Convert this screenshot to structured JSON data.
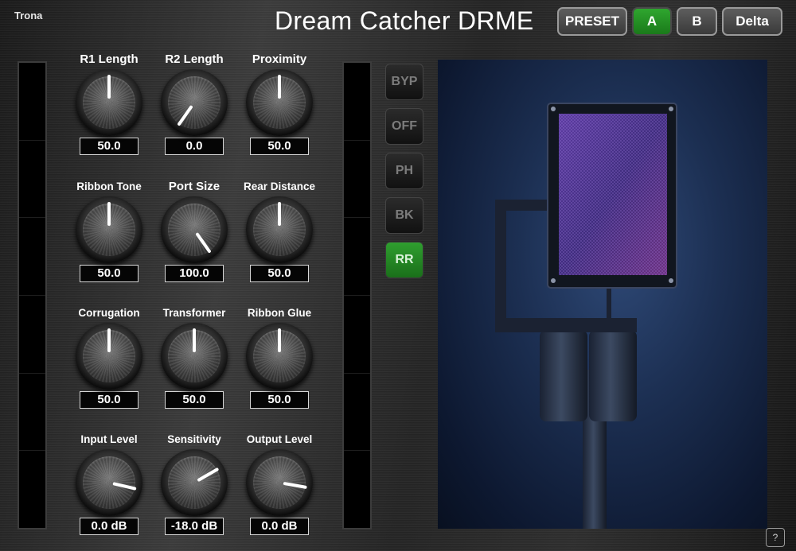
{
  "brand": "Trona",
  "title": "Dream Catcher DRME",
  "top_buttons": {
    "preset": "PRESET",
    "a": "A",
    "b": "B",
    "delta": "Delta",
    "active": "A"
  },
  "controls": [
    {
      "label": "R1 Length",
      "value": "50.0"
    },
    {
      "label": "R2 Length",
      "value": "0.0"
    },
    {
      "label": "Proximity",
      "value": "50.0"
    },
    {
      "label": "Ribbon Tone",
      "value": "50.0"
    },
    {
      "label": "Port Size",
      "value": "100.0"
    },
    {
      "label": "Rear Distance",
      "value": "50.0"
    },
    {
      "label": "Corrugation",
      "value": "50.0"
    },
    {
      "label": "Transformer",
      "value": "50.0"
    },
    {
      "label": "Ribbon Glue",
      "value": "50.0"
    },
    {
      "label": "Input Level",
      "value": "0.0 dB"
    },
    {
      "label": "Sensitivity",
      "value": "-18.0 dB"
    },
    {
      "label": "Output Level",
      "value": "0.0 dB"
    }
  ],
  "modes": [
    {
      "label": "BYP",
      "active": false
    },
    {
      "label": "OFF",
      "active": false
    },
    {
      "label": "PH",
      "active": false
    },
    {
      "label": "BK",
      "active": false
    },
    {
      "label": "RR",
      "active": true
    }
  ],
  "help": "?",
  "colors": {
    "active_green": "#1f8a1f",
    "panel_dark": "#2a2a2a",
    "photo_blue": "#1c2f52",
    "grille_purple": "#4a2f8a"
  },
  "icons": {
    "microphone_image": "ribbon-microphone-icon",
    "help": "help-icon"
  }
}
